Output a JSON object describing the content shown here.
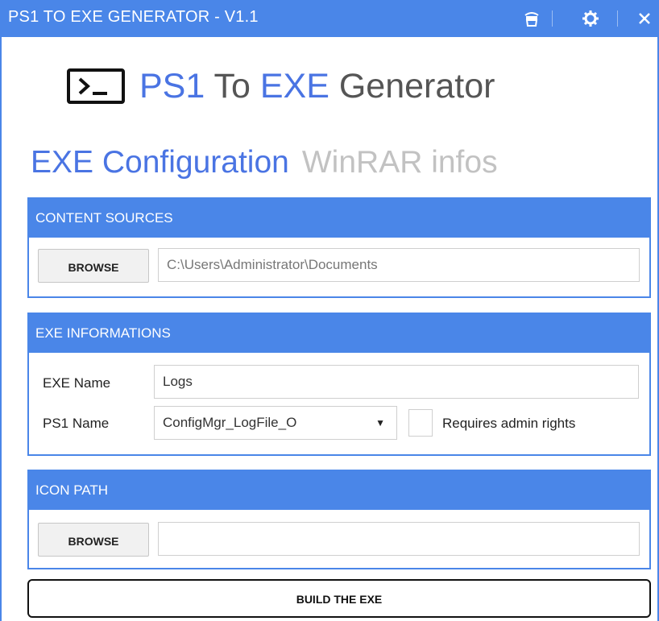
{
  "window": {
    "title": "PS1 TO EXE GENERATOR - V1.1"
  },
  "hero": {
    "part1": "PS1",
    "part2": "To",
    "part3": "EXE",
    "part4": "Generator"
  },
  "tabs": [
    {
      "label": "EXE Configuration"
    },
    {
      "label": "WinRAR infos"
    }
  ],
  "content_sources": {
    "header": "CONTENT SOURCES",
    "browse_label": "BROWSE",
    "path_value": "C:\\Users\\Administrator\\Documents"
  },
  "exe_informations": {
    "header": "EXE INFORMATIONS",
    "exe_name_label": "EXE Name",
    "exe_name_value": "Logs",
    "ps1_name_label": "PS1 Name",
    "ps1_name_value": "ConfigMgr_LogFile_O",
    "admin_label": "Requires admin rights"
  },
  "icon_path": {
    "header": "ICON PATH",
    "browse_label": "BROWSE",
    "path_value": ""
  },
  "build_label": "BUILD THE EXE",
  "colors": {
    "accent": "#4a86e8",
    "heading_blue": "#4a74e3",
    "inactive_tab": "#c2c2c2"
  },
  "icons": [
    "cup-icon",
    "gear-icon",
    "close-icon",
    "terminal-icon",
    "chevron-down-icon"
  ]
}
